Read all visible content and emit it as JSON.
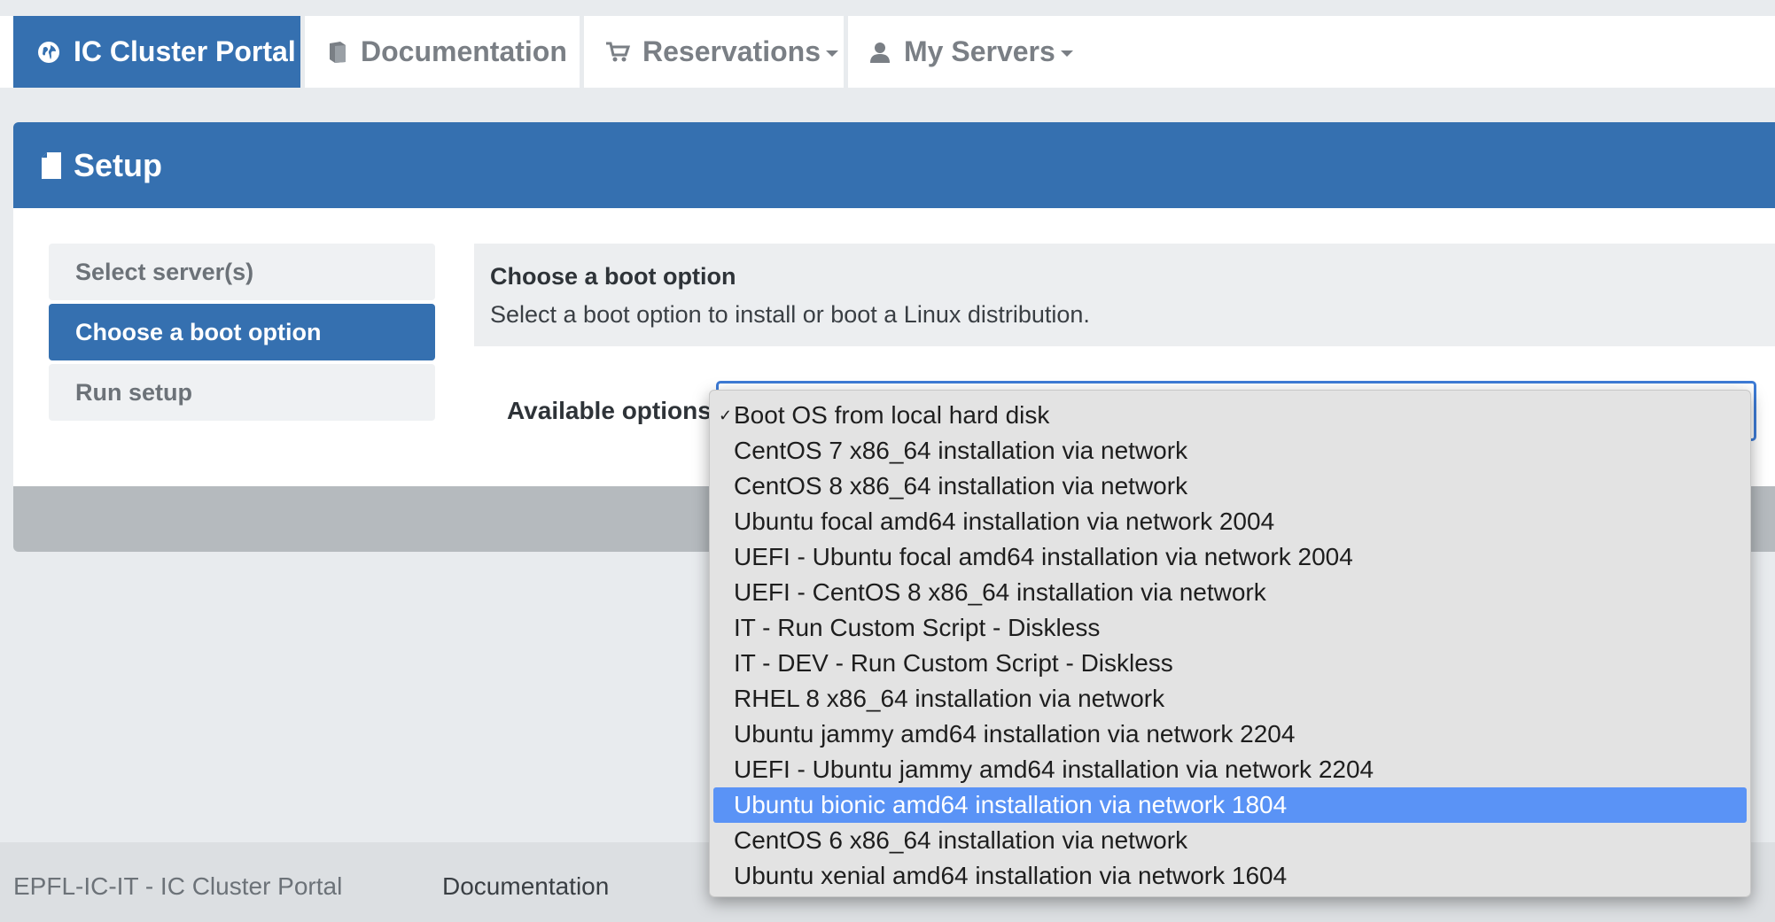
{
  "nav": {
    "brand": "IC Cluster Portal",
    "documentation": "Documentation",
    "reservations": "Reservations",
    "my_servers": "My Servers"
  },
  "panel": {
    "title": "Setup"
  },
  "steps": [
    {
      "label": "Select server(s)",
      "active": false
    },
    {
      "label": "Choose a boot option",
      "active": true
    },
    {
      "label": "Run setup",
      "active": false
    }
  ],
  "info": {
    "title": "Choose a boot option",
    "description": "Select a boot option to install or boot a Linux distribution."
  },
  "form": {
    "label": "Available options",
    "checked_index": 0,
    "highlighted_index": 11,
    "options": [
      "Boot OS from local hard disk",
      "CentOS 7 x86_64 installation via network",
      "CentOS 8 x86_64 installation via network",
      "Ubuntu focal amd64 installation via network 2004",
      "UEFI - Ubuntu focal amd64 installation via network 2004",
      "UEFI - CentOS 8 x86_64 installation via network",
      "IT - Run Custom Script - Diskless",
      "IT - DEV - Run Custom Script - Diskless",
      "RHEL 8 x86_64 installation via network",
      "Ubuntu jammy amd64 installation via network 2204",
      "UEFI - Ubuntu jammy amd64 installation via network 2204",
      "Ubuntu bionic amd64 installation via network 1804",
      "CentOS 6 x86_64 installation via network",
      "Ubuntu xenial amd64 installation via network 1604"
    ]
  },
  "footer": {
    "copyright": "EPFL-IC-IT - IC Cluster Portal",
    "documentation": "Documentation"
  },
  "colors": {
    "primary": "#3570b0",
    "highlight": "#5a93f6",
    "focus_border": "#3d7bd6"
  }
}
